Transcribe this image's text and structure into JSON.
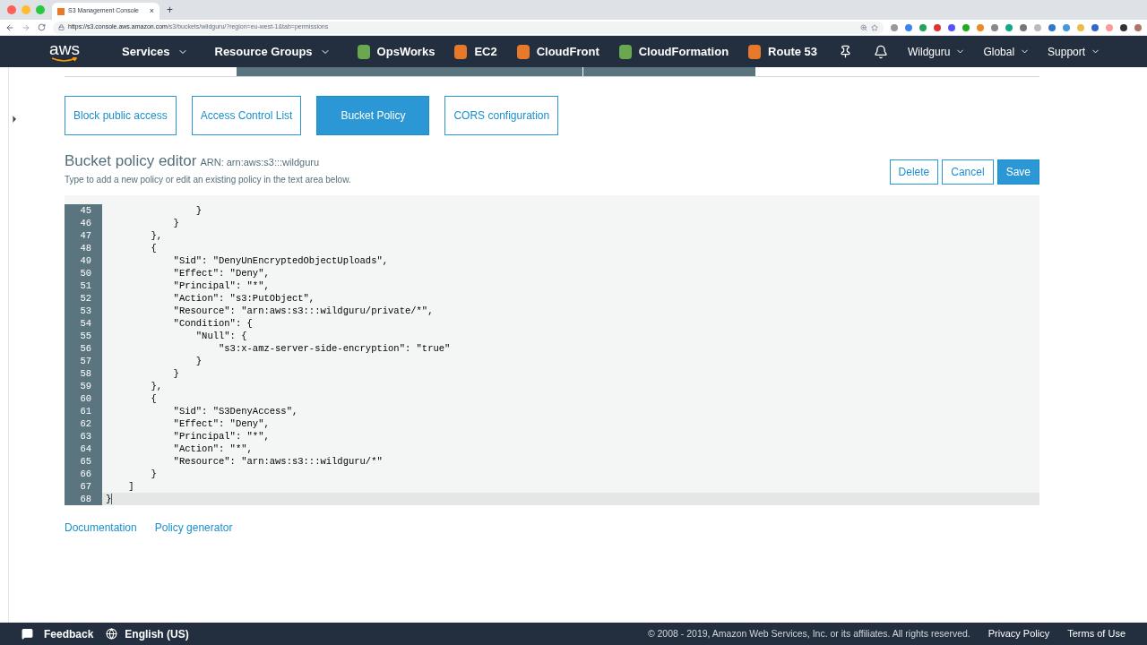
{
  "browser": {
    "tab_title": "S3 Management Console",
    "new_tab": "+",
    "tab_close": "×",
    "url_host": "https://s3.console.aws.amazon.com",
    "url_path": "/s3/buckets/wildguru/?region=eu-west-1&tab=permissions"
  },
  "nav": {
    "logo": "aws",
    "menus": [
      {
        "label": "Services"
      },
      {
        "label": "Resource Groups"
      }
    ],
    "shortcuts": [
      {
        "label": "OpsWorks",
        "color": "#6aa84f"
      },
      {
        "label": "EC2",
        "color": "#e8792b"
      },
      {
        "label": "CloudFront",
        "color": "#e8792b"
      },
      {
        "label": "CloudFormation",
        "color": "#6aa84f"
      },
      {
        "label": "Route 53",
        "color": "#e8792b"
      }
    ],
    "right_menus": [
      {
        "label": "Wildguru"
      },
      {
        "label": "Global"
      },
      {
        "label": "Support"
      }
    ]
  },
  "tabs": [
    {
      "label": "Block public access",
      "selected": false
    },
    {
      "label": "Access Control List",
      "selected": false
    },
    {
      "label": "Bucket Policy",
      "selected": true
    },
    {
      "label": "CORS configuration",
      "selected": false
    }
  ],
  "editor": {
    "title": "Bucket policy editor",
    "arn": "ARN: arn:aws:s3:::wildguru",
    "hint": "Type to add a new policy or edit an existing policy in the text area below.",
    "buttons": [
      "Delete",
      "Cancel",
      "Save"
    ],
    "lines": [
      {
        "number": "45",
        "text": "                }",
        "active": false
      },
      {
        "number": "46",
        "text": "            }",
        "active": false
      },
      {
        "number": "47",
        "text": "        },",
        "active": false
      },
      {
        "number": "48",
        "text": "        {",
        "active": false
      },
      {
        "number": "49",
        "text": "            \"Sid\": \"DenyUnEncryptedObjectUploads\",",
        "active": false
      },
      {
        "number": "50",
        "text": "            \"Effect\": \"Deny\",",
        "active": false
      },
      {
        "number": "51",
        "text": "            \"Principal\": \"*\",",
        "active": false
      },
      {
        "number": "52",
        "text": "            \"Action\": \"s3:PutObject\",",
        "active": false
      },
      {
        "number": "53",
        "text": "            \"Resource\": \"arn:aws:s3:::wildguru/private/*\",",
        "active": false
      },
      {
        "number": "54",
        "text": "            \"Condition\": {",
        "active": false
      },
      {
        "number": "55",
        "text": "                \"Null\": {",
        "active": false
      },
      {
        "number": "56",
        "text": "                    \"s3:x-amz-server-side-encryption\": \"true\"",
        "active": false
      },
      {
        "number": "57",
        "text": "                }",
        "active": false
      },
      {
        "number": "58",
        "text": "            }",
        "active": false
      },
      {
        "number": "59",
        "text": "        },",
        "active": false
      },
      {
        "number": "60",
        "text": "        {",
        "active": false
      },
      {
        "number": "61",
        "text": "            \"Sid\": \"S3DenyAccess\",",
        "active": false
      },
      {
        "number": "62",
        "text": "            \"Effect\": \"Deny\",",
        "active": false
      },
      {
        "number": "63",
        "text": "            \"Principal\": \"*\",",
        "active": false
      },
      {
        "number": "64",
        "text": "            \"Action\": \"*\",",
        "active": false
      },
      {
        "number": "65",
        "text": "            \"Resource\": \"arn:aws:s3:::wildguru/*\"",
        "active": false
      },
      {
        "number": "66",
        "text": "        }",
        "active": false
      },
      {
        "number": "67",
        "text": "    ]",
        "active": false
      },
      {
        "number": "68",
        "text": "}",
        "active": true
      }
    ]
  },
  "links": [
    "Documentation",
    "Policy generator"
  ],
  "footer": {
    "feedback": "Feedback",
    "language": "English (US)",
    "copyright": "© 2008 - 2019, Amazon Web Services, Inc. or its affiliates. All rights reserved.",
    "links": [
      "Privacy Policy",
      "Terms of Use"
    ]
  }
}
